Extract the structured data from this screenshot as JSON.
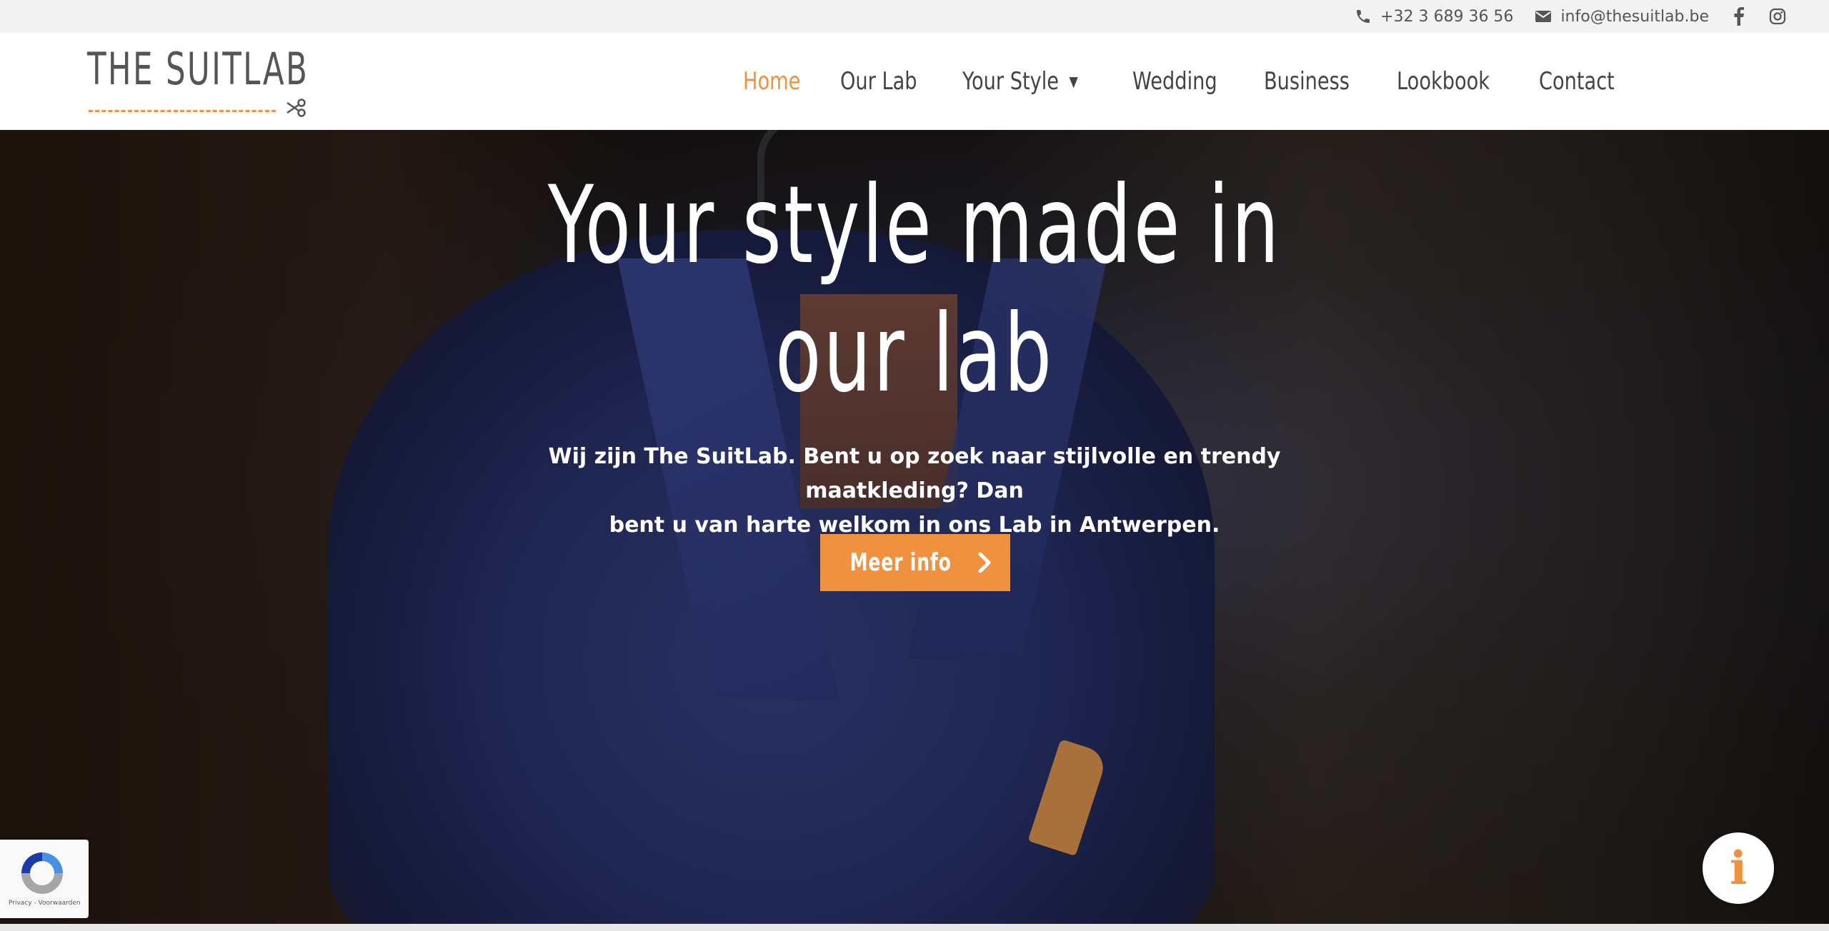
{
  "topbar": {
    "phone": "+32 3 689 36 56",
    "email": "info@thesuitlab.be",
    "social": [
      "facebook-icon",
      "instagram-icon"
    ]
  },
  "header": {
    "logo_text": "THE SUITLAB",
    "nav": [
      {
        "label": "Home",
        "active": true
      },
      {
        "label": "Our Lab"
      },
      {
        "label": "Your Style",
        "has_dropdown": true
      },
      {
        "label": "Wedding"
      },
      {
        "label": "Business"
      },
      {
        "label": "Lookbook"
      },
      {
        "label": "Contact"
      }
    ]
  },
  "hero": {
    "title_line1": "Your style made in",
    "title_line2": "our lab",
    "subtitle_line1": "Wij zijn The SuitLab. Bent u op zoek naar stijlvolle en trendy maatkleding? Dan",
    "subtitle_line2": "bent u van harte welkom in ons Lab in Antwerpen.",
    "button_label": "Meer info",
    "button_icon": "chevron-right-icon"
  },
  "recaptcha": {
    "text": "Privacy - Voorwaarden"
  },
  "info_button": {
    "glyph": "i"
  },
  "colors": {
    "accent": "#f0913f",
    "topbar_bg": "#f2f2f2",
    "nav_text": "#444444"
  }
}
